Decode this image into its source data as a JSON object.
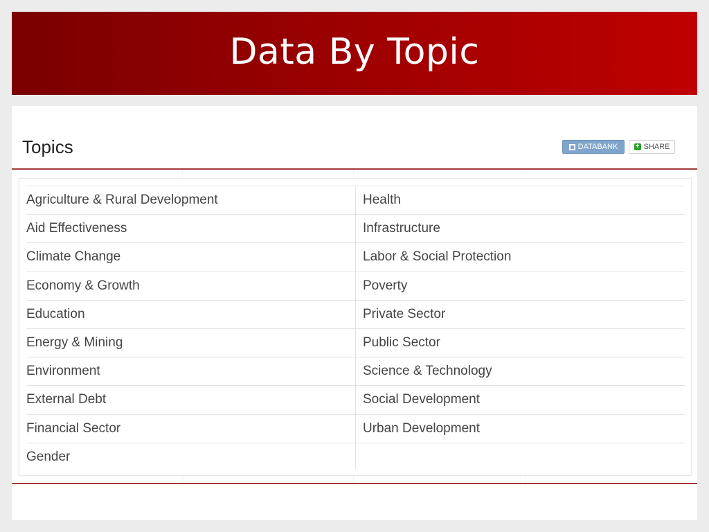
{
  "slide": {
    "title": "Data By Topic"
  },
  "page": {
    "heading": "Topics",
    "buttons": {
      "databank": "DATABANK",
      "share": "SHARE"
    },
    "colors": {
      "accent": "#a33a3a",
      "banner_start": "#7a0000",
      "banner_end": "#bf0000",
      "databank_button": "#7fa5cc",
      "share_icon": "#2aa12a"
    },
    "topics_left": [
      "Agriculture & Rural Development",
      "Aid Effectiveness",
      "Climate Change",
      "Economy & Growth",
      "Education",
      "Energy & Mining",
      "Environment",
      "External Debt",
      "Financial Sector",
      "Gender"
    ],
    "topics_right": [
      "Health",
      "Infrastructure",
      "Labor & Social Protection",
      "Poverty",
      "Private Sector",
      "Public Sector",
      "Science & Technology",
      "Social Development",
      "Urban Development"
    ]
  }
}
